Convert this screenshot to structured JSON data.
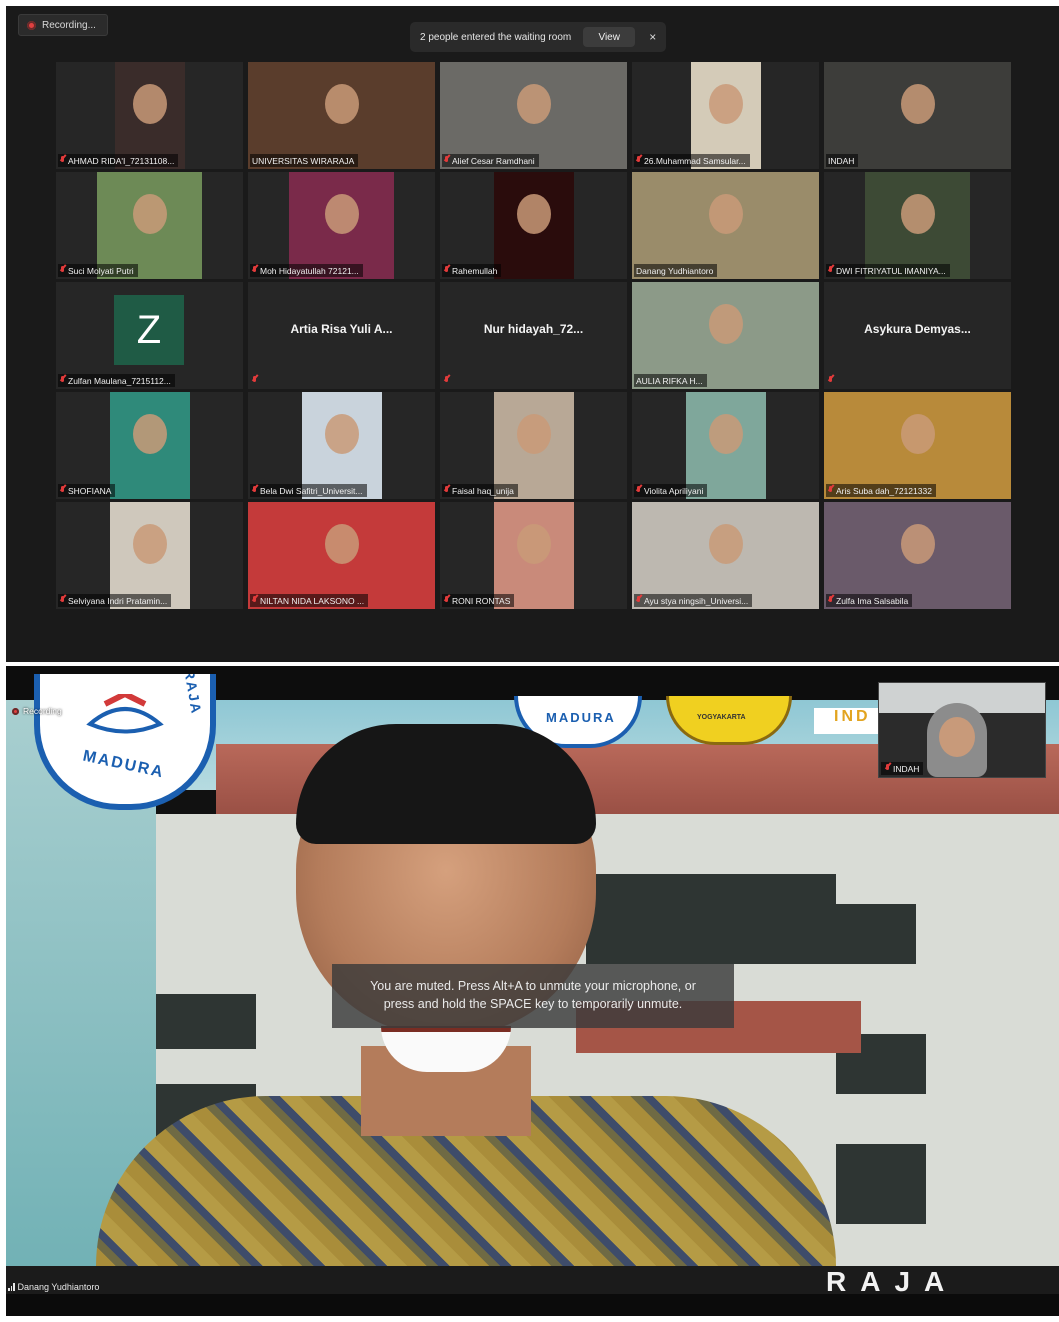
{
  "gallery": {
    "recording_label": "Recording...",
    "waiting_room": {
      "message": "2 people entered the waiting room",
      "view_label": "View",
      "close_glyph": "×"
    },
    "participants": [
      {
        "name": "AHMAD RIDA'I_72131108...",
        "muted": true,
        "kind": "video",
        "bg": "#3a2c2a"
      },
      {
        "name": "UNIVERSITAS WIRARAJA",
        "muted": false,
        "kind": "video",
        "bg": "#5a3d2c",
        "active_speaker": true
      },
      {
        "name": "Alief Cesar Ramdhani",
        "muted": true,
        "kind": "video",
        "bg": "#6b6a66"
      },
      {
        "name": "26.Muhammad Samsular...",
        "muted": true,
        "kind": "video",
        "bg": "#d4cbb8"
      },
      {
        "name": "INDAH",
        "muted": false,
        "kind": "video",
        "bg": "#3d3d3a"
      },
      {
        "name": "Suci Molyati Putri",
        "muted": true,
        "kind": "video",
        "bg": "#6d8a56"
      },
      {
        "name": "Moh Hidayatullah 72121...",
        "muted": true,
        "kind": "video",
        "bg": "#7a2a4a"
      },
      {
        "name": "Rahemullah",
        "muted": true,
        "kind": "video",
        "bg": "#2a0c0c"
      },
      {
        "name": "Danang Yudhiantoro",
        "muted": false,
        "kind": "video",
        "bg": "#9a8c6a"
      },
      {
        "name": "DWI FITRIYATUL IMANIYA...",
        "muted": true,
        "kind": "video",
        "bg": "#3d4a35"
      },
      {
        "name": "Zulfan Maulana_7215112...",
        "muted": true,
        "kind": "avatar",
        "avatar_letter": "Z"
      },
      {
        "name": "",
        "display_name": "Artia Risa Yuli A...",
        "muted": true,
        "kind": "name"
      },
      {
        "name": "",
        "display_name": "Nur hidayah_72...",
        "muted": true,
        "kind": "name"
      },
      {
        "name": "AULIA RIFKA H...",
        "muted": false,
        "kind": "video",
        "bg": "#8c9a88"
      },
      {
        "name": "",
        "display_name": "Asykura Demyas...",
        "muted": true,
        "kind": "name"
      },
      {
        "name": "SHOFIANA",
        "muted": true,
        "kind": "video",
        "bg": "#2f8a7a"
      },
      {
        "name": "Bela Dwi Safitri_Universit...",
        "muted": true,
        "kind": "video",
        "bg": "#c9d3dc"
      },
      {
        "name": "Faisal haq_unija",
        "muted": true,
        "kind": "video",
        "bg": "#b8a896"
      },
      {
        "name": "Violita Apriliyani",
        "muted": true,
        "kind": "video",
        "bg": "#7fa79b"
      },
      {
        "name": "Aris Suba dah_72121332",
        "muted": true,
        "kind": "video",
        "bg": "#b88a3a"
      },
      {
        "name": "Selviyana Indri Pratamin...",
        "muted": true,
        "kind": "video",
        "bg": "#cfc8bc"
      },
      {
        "name": "NILTAN NIDA LAKSONO ...",
        "muted": true,
        "kind": "video",
        "bg": "#c43a3a"
      },
      {
        "name": "RONI RONTAS",
        "muted": true,
        "kind": "video",
        "bg": "#c98a7a"
      },
      {
        "name": "Ayu stya ningsih_Universi...",
        "muted": true,
        "kind": "video",
        "bg": "#bdb8b0"
      },
      {
        "name": "Zulfa Ima Salsabila",
        "muted": true,
        "kind": "video",
        "bg": "#6a5a6a"
      }
    ]
  },
  "speaker_view": {
    "recording_label": "Recording",
    "self_view_name": "INDAH",
    "banner_text_left": "MADURA",
    "banner_text_arc": "RAJA",
    "banner_text_center": "MADURA",
    "banner_text_yogya": "YOGYAKARTA",
    "banner_text_right": "IND",
    "bottom_sign": "RAJA",
    "muted_toast": {
      "line1": "You are muted. Press Alt+A to unmute your microphone, or",
      "line2": "press and hold the SPACE key to temporarily unmute."
    },
    "active_speaker_name": "Danang Yudhiantoro"
  },
  "colors": {
    "active_speaker_border": "#c9e55b",
    "muted_icon": "#e23b3b",
    "recording_dot": "#e04040",
    "gallery_background": "#1a1a1a"
  }
}
